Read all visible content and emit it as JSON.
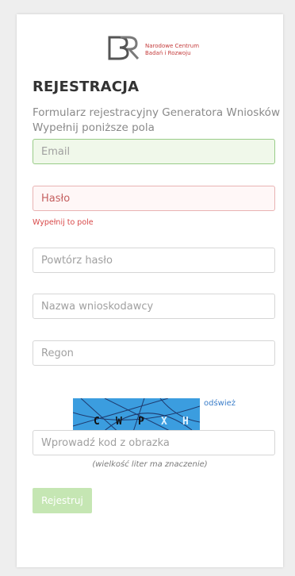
{
  "logo": {
    "line1": "Narodowe Centrum",
    "line2": "Badań i Rozwoju"
  },
  "form": {
    "title": "REJESTRACJA",
    "subtitle": "Formularz rejestracyjny Generatora Wniosków",
    "subtitle2": "Wypełnij poniższe pola",
    "email_placeholder": "Email",
    "password_placeholder": "Hasło",
    "password_error": "Wypełnij to pole",
    "repeat_placeholder": "Powtórz hasło",
    "applicant_placeholder": "Nazwa wnioskodawcy",
    "regon_placeholder": "Regon",
    "captcha_text": [
      "C",
      "W",
      "P",
      "X",
      "H"
    ],
    "refresh_label": "odśwież",
    "captcha_placeholder": "Wprowadź kod z obrazka",
    "case_hint": "(wielkość liter ma znaczenie)",
    "submit_label": "Rejestruj"
  },
  "colors": {
    "accent_red": "#c43c3c",
    "success_bg": "#f0f8ea",
    "error_text": "#d84848",
    "captcha_bg": "#3b9ddf",
    "submit_bg": "#c5e6b3"
  }
}
